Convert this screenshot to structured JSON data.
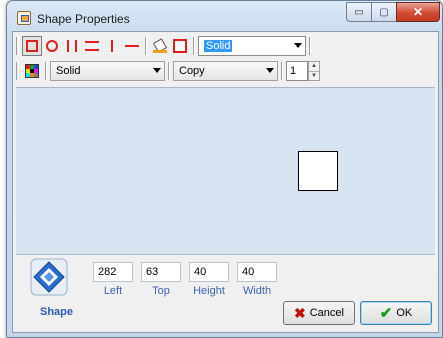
{
  "window": {
    "title": "Shape Properties",
    "minimize_glyph": "▭",
    "maximize_glyph": "▢",
    "close_glyph": "✕"
  },
  "toolbar1": {
    "tools": [
      {
        "name": "rectangle-tool",
        "icon": "rectangle-icon",
        "active": true
      },
      {
        "name": "circle-tool",
        "icon": "circle-icon"
      },
      {
        "name": "vertical-lines-tool",
        "icon": "vertical-lines-icon"
      },
      {
        "name": "horizontal-lines-tool",
        "icon": "horizontal-lines-icon"
      },
      {
        "name": "vertical-line-tool",
        "icon": "vertical-line-icon"
      },
      {
        "name": "horizontal-line-tool",
        "icon": "horizontal-line-icon"
      }
    ],
    "fill_style": "Solid"
  },
  "toolbar2": {
    "line_style": "Solid",
    "draw_mode": "Copy",
    "line_width": "1"
  },
  "preview": {
    "shape_color": "#ffffff",
    "background": "#d6e3f0"
  },
  "geometry": {
    "left": "282",
    "top": "63",
    "height": "40",
    "width": "40",
    "left_label": "Left",
    "top_label": "Top",
    "height_label": "Height",
    "width_label": "Width"
  },
  "section_label": "Shape",
  "buttons": {
    "cancel": "Cancel",
    "ok": "OK"
  },
  "colors": {
    "accent": "#2a5bb0",
    "tool_red": "#e02020",
    "selection": "#3399ff"
  }
}
